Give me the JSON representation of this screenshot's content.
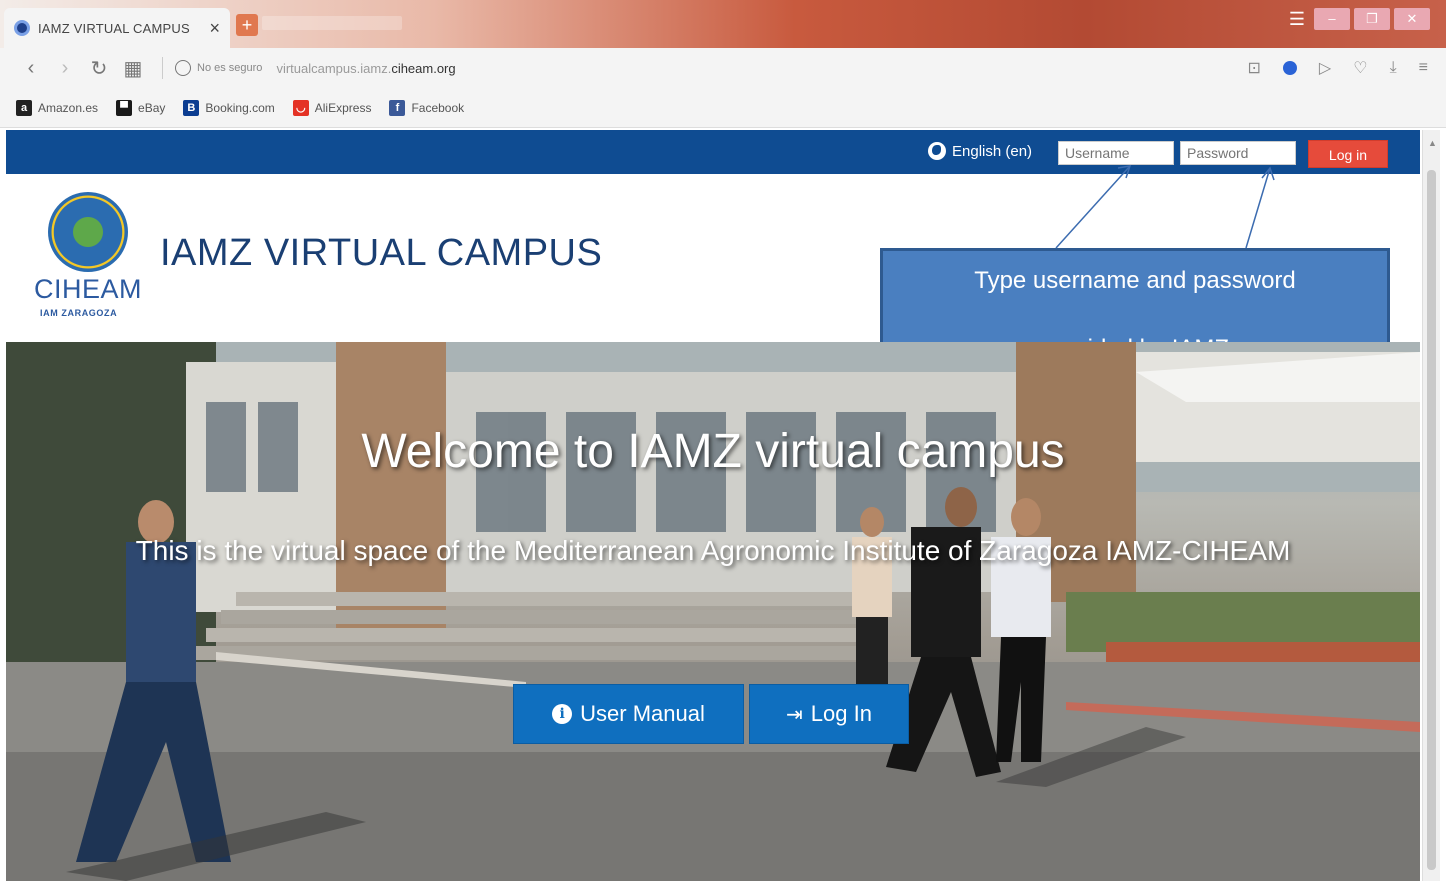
{
  "browser": {
    "tab_title": "IAMZ VIRTUAL CAMPUS",
    "tab_close": "×",
    "new_tab": "+",
    "security_label": "No es seguro",
    "url_prefix": "virtualcampus.iamz.",
    "url_domain": "ciheam.org",
    "bookmarks": [
      {
        "label": "Amazon.es",
        "icon": "amazon-icon",
        "color": "#222222"
      },
      {
        "label": "eBay",
        "icon": "ebay-icon",
        "color": "#1a1a1a"
      },
      {
        "label": "Booking.com",
        "icon": "booking-icon",
        "color": "#0b3d91"
      },
      {
        "label": "AliExpress",
        "icon": "aliexpress-icon",
        "color": "#e43225"
      },
      {
        "label": "Facebook",
        "icon": "facebook-icon",
        "color": "#3b5998"
      }
    ]
  },
  "topnav": {
    "language": "English (en)",
    "username_placeholder": "Username",
    "password_placeholder": "Password",
    "login_label": "Log in"
  },
  "header": {
    "logo_text": "CIHEAM",
    "logo_subtext": "IAM ZARAGOZA",
    "site_title": "IAMZ VIRTUAL CAMPUS"
  },
  "annotation": {
    "line1": "Type username and password",
    "line2": "provided by IAMZ"
  },
  "hero": {
    "welcome": "Welcome to IAMZ virtual campus",
    "subtitle": "This is the virtual space of the Mediterranean Agronomic Institute of Zaragoza IAMZ-CIHEAM",
    "manual_button": "User Manual",
    "login_button": "Log In"
  },
  "colors": {
    "navbar": "#0f4c92",
    "login_button": "#e64b3b",
    "hero_button": "#0f6fbf",
    "annotation_box": "#4a7fc0",
    "title": "#1a3f73"
  }
}
